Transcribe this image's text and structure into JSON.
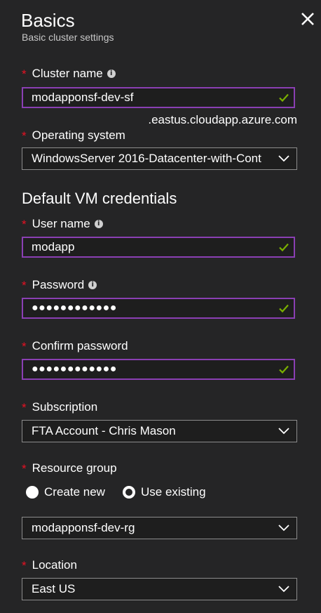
{
  "header": {
    "title": "Basics",
    "subtitle": "Basic cluster settings"
  },
  "cluster_name": {
    "label": "Cluster name",
    "value": "modapponsf-dev-sf",
    "suffix": ".eastus.cloudapp.azure.com"
  },
  "operating_system": {
    "label": "Operating system",
    "value": "WindowsServer 2016-Datacenter-with-Cont"
  },
  "credentials_heading": "Default VM credentials",
  "user_name": {
    "label": "User name",
    "value": "modapp"
  },
  "password": {
    "label": "Password",
    "value": "●●●●●●●●●●●●"
  },
  "confirm_password": {
    "label": "Confirm password",
    "value": "●●●●●●●●●●●●"
  },
  "subscription": {
    "label": "Subscription",
    "value": "FTA Account - Chris Mason"
  },
  "resource_group": {
    "label": "Resource group",
    "option_create": "Create new",
    "option_existing": "Use existing",
    "value": "modapponsf-dev-rg"
  },
  "location": {
    "label": "Location",
    "value": "East US"
  },
  "required_mark": "*",
  "info_glyph": "i",
  "colors": {
    "background": "#252526",
    "required": "#e81123",
    "valid_check": "#7ab000",
    "focus_border": "#8a3fb3"
  }
}
